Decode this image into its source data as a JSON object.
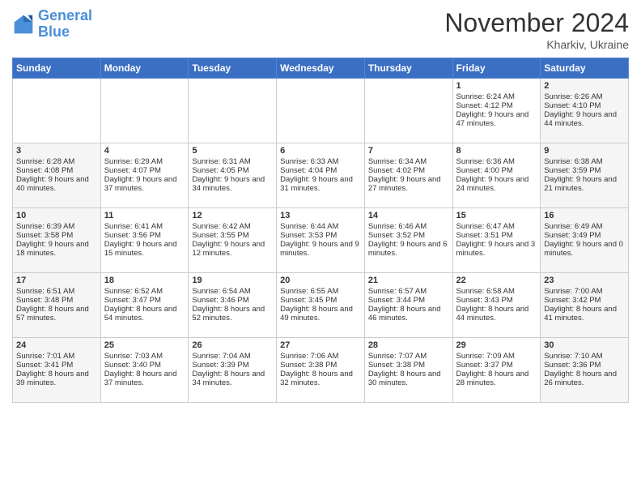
{
  "logo": {
    "line1": "General",
    "line2": "Blue"
  },
  "title": "November 2024",
  "location": "Kharkiv, Ukraine",
  "weekdays": [
    "Sunday",
    "Monday",
    "Tuesday",
    "Wednesday",
    "Thursday",
    "Friday",
    "Saturday"
  ],
  "weeks": [
    [
      {
        "day": "",
        "sunrise": "",
        "sunset": "",
        "daylight": ""
      },
      {
        "day": "",
        "sunrise": "",
        "sunset": "",
        "daylight": ""
      },
      {
        "day": "",
        "sunrise": "",
        "sunset": "",
        "daylight": ""
      },
      {
        "day": "",
        "sunrise": "",
        "sunset": "",
        "daylight": ""
      },
      {
        "day": "",
        "sunrise": "",
        "sunset": "",
        "daylight": ""
      },
      {
        "day": "1",
        "sunrise": "Sunrise: 6:24 AM",
        "sunset": "Sunset: 4:12 PM",
        "daylight": "Daylight: 9 hours and 47 minutes."
      },
      {
        "day": "2",
        "sunrise": "Sunrise: 6:26 AM",
        "sunset": "Sunset: 4:10 PM",
        "daylight": "Daylight: 9 hours and 44 minutes."
      }
    ],
    [
      {
        "day": "3",
        "sunrise": "Sunrise: 6:28 AM",
        "sunset": "Sunset: 4:08 PM",
        "daylight": "Daylight: 9 hours and 40 minutes."
      },
      {
        "day": "4",
        "sunrise": "Sunrise: 6:29 AM",
        "sunset": "Sunset: 4:07 PM",
        "daylight": "Daylight: 9 hours and 37 minutes."
      },
      {
        "day": "5",
        "sunrise": "Sunrise: 6:31 AM",
        "sunset": "Sunset: 4:05 PM",
        "daylight": "Daylight: 9 hours and 34 minutes."
      },
      {
        "day": "6",
        "sunrise": "Sunrise: 6:33 AM",
        "sunset": "Sunset: 4:04 PM",
        "daylight": "Daylight: 9 hours and 31 minutes."
      },
      {
        "day": "7",
        "sunrise": "Sunrise: 6:34 AM",
        "sunset": "Sunset: 4:02 PM",
        "daylight": "Daylight: 9 hours and 27 minutes."
      },
      {
        "day": "8",
        "sunrise": "Sunrise: 6:36 AM",
        "sunset": "Sunset: 4:00 PM",
        "daylight": "Daylight: 9 hours and 24 minutes."
      },
      {
        "day": "9",
        "sunrise": "Sunrise: 6:38 AM",
        "sunset": "Sunset: 3:59 PM",
        "daylight": "Daylight: 9 hours and 21 minutes."
      }
    ],
    [
      {
        "day": "10",
        "sunrise": "Sunrise: 6:39 AM",
        "sunset": "Sunset: 3:58 PM",
        "daylight": "Daylight: 9 hours and 18 minutes."
      },
      {
        "day": "11",
        "sunrise": "Sunrise: 6:41 AM",
        "sunset": "Sunset: 3:56 PM",
        "daylight": "Daylight: 9 hours and 15 minutes."
      },
      {
        "day": "12",
        "sunrise": "Sunrise: 6:42 AM",
        "sunset": "Sunset: 3:55 PM",
        "daylight": "Daylight: 9 hours and 12 minutes."
      },
      {
        "day": "13",
        "sunrise": "Sunrise: 6:44 AM",
        "sunset": "Sunset: 3:53 PM",
        "daylight": "Daylight: 9 hours and 9 minutes."
      },
      {
        "day": "14",
        "sunrise": "Sunrise: 6:46 AM",
        "sunset": "Sunset: 3:52 PM",
        "daylight": "Daylight: 9 hours and 6 minutes."
      },
      {
        "day": "15",
        "sunrise": "Sunrise: 6:47 AM",
        "sunset": "Sunset: 3:51 PM",
        "daylight": "Daylight: 9 hours and 3 minutes."
      },
      {
        "day": "16",
        "sunrise": "Sunrise: 6:49 AM",
        "sunset": "Sunset: 3:49 PM",
        "daylight": "Daylight: 9 hours and 0 minutes."
      }
    ],
    [
      {
        "day": "17",
        "sunrise": "Sunrise: 6:51 AM",
        "sunset": "Sunset: 3:48 PM",
        "daylight": "Daylight: 8 hours and 57 minutes."
      },
      {
        "day": "18",
        "sunrise": "Sunrise: 6:52 AM",
        "sunset": "Sunset: 3:47 PM",
        "daylight": "Daylight: 8 hours and 54 minutes."
      },
      {
        "day": "19",
        "sunrise": "Sunrise: 6:54 AM",
        "sunset": "Sunset: 3:46 PM",
        "daylight": "Daylight: 8 hours and 52 minutes."
      },
      {
        "day": "20",
        "sunrise": "Sunrise: 6:55 AM",
        "sunset": "Sunset: 3:45 PM",
        "daylight": "Daylight: 8 hours and 49 minutes."
      },
      {
        "day": "21",
        "sunrise": "Sunrise: 6:57 AM",
        "sunset": "Sunset: 3:44 PM",
        "daylight": "Daylight: 8 hours and 46 minutes."
      },
      {
        "day": "22",
        "sunrise": "Sunrise: 6:58 AM",
        "sunset": "Sunset: 3:43 PM",
        "daylight": "Daylight: 8 hours and 44 minutes."
      },
      {
        "day": "23",
        "sunrise": "Sunrise: 7:00 AM",
        "sunset": "Sunset: 3:42 PM",
        "daylight": "Daylight: 8 hours and 41 minutes."
      }
    ],
    [
      {
        "day": "24",
        "sunrise": "Sunrise: 7:01 AM",
        "sunset": "Sunset: 3:41 PM",
        "daylight": "Daylight: 8 hours and 39 minutes."
      },
      {
        "day": "25",
        "sunrise": "Sunrise: 7:03 AM",
        "sunset": "Sunset: 3:40 PM",
        "daylight": "Daylight: 8 hours and 37 minutes."
      },
      {
        "day": "26",
        "sunrise": "Sunrise: 7:04 AM",
        "sunset": "Sunset: 3:39 PM",
        "daylight": "Daylight: 8 hours and 34 minutes."
      },
      {
        "day": "27",
        "sunrise": "Sunrise: 7:06 AM",
        "sunset": "Sunset: 3:38 PM",
        "daylight": "Daylight: 8 hours and 32 minutes."
      },
      {
        "day": "28",
        "sunrise": "Sunrise: 7:07 AM",
        "sunset": "Sunset: 3:38 PM",
        "daylight": "Daylight: 8 hours and 30 minutes."
      },
      {
        "day": "29",
        "sunrise": "Sunrise: 7:09 AM",
        "sunset": "Sunset: 3:37 PM",
        "daylight": "Daylight: 8 hours and 28 minutes."
      },
      {
        "day": "30",
        "sunrise": "Sunrise: 7:10 AM",
        "sunset": "Sunset: 3:36 PM",
        "daylight": "Daylight: 8 hours and 26 minutes."
      }
    ]
  ]
}
